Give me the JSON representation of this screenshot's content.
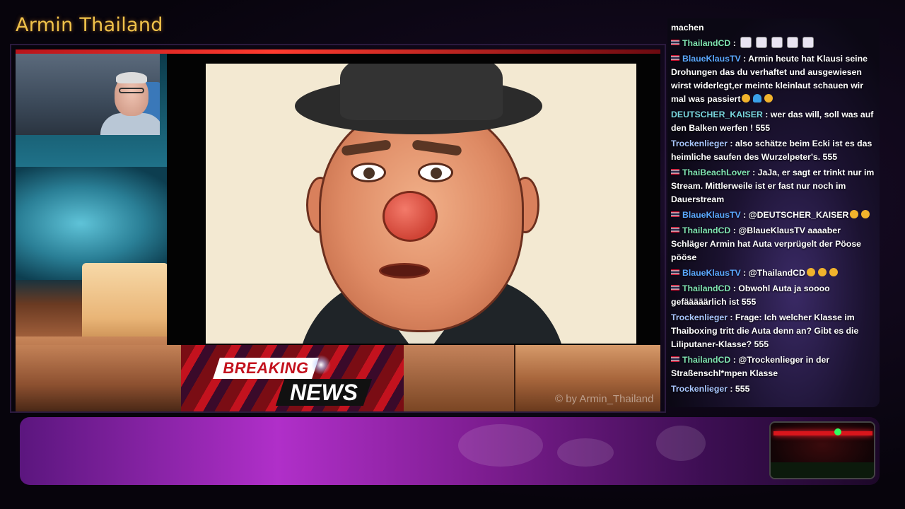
{
  "overlay": {
    "title": "Armin Thailand",
    "watermark": "© by Armin_Thailand"
  },
  "banner": {
    "breaking": "BREAKING",
    "news": "NEWS"
  },
  "chat": {
    "lead_text": "machen",
    "messages": [
      {
        "user": "ThailandCD",
        "user_color": "#7fe3b0",
        "flag": true,
        "text": "",
        "emotes": 5
      },
      {
        "user": "BlaueKlausTV",
        "user_color": "#5ba8ff",
        "flag": true,
        "text": "Armin heute hat Klausi seine Drohungen das du verhaftet und ausgewiesen wirst widerlegt,er meinte kleinlaut schauen wir mal was passiert"
      },
      {
        "user": "DEUTSCHER_KAISER",
        "user_color": "#7ad7e0",
        "flag": false,
        "text": "wer das will, soll was auf den Balken werfen ! 555"
      },
      {
        "user": "Trockenlieger",
        "user_color": "#a9c6ff",
        "flag": false,
        "text": "also schätze beim Ecki ist es das heimliche saufen des Wurzelpeter's. 555"
      },
      {
        "user": "ThaiBeachLover",
        "user_color": "#7fe3b0",
        "flag": true,
        "text": "JaJa, er sagt er trinkt nur im Stream. Mittlerweile ist er fast nur noch im Dauerstream"
      },
      {
        "user": "BlaueKlausTV",
        "user_color": "#5ba8ff",
        "flag": true,
        "text": "@DEUTSCHER_KAISER"
      },
      {
        "user": "ThailandCD",
        "user_color": "#7fe3b0",
        "flag": true,
        "text": "@BlaueKlausTV aaaaber Schläger Armin hat Auta verprügelt der Pöose pööse"
      },
      {
        "user": "BlaueKlausTV",
        "user_color": "#5ba8ff",
        "flag": true,
        "text": "@ThailandCD"
      },
      {
        "user": "ThailandCD",
        "user_color": "#7fe3b0",
        "flag": true,
        "text": "Obwohl Auta ja soooo gefääääärlich ist 555"
      },
      {
        "user": "Trockenlieger",
        "user_color": "#a9c6ff",
        "flag": false,
        "text": "Frage: Ich welcher Klasse im Thaiboxing tritt die Auta denn an? Gibt es die Liliputaner-Klasse? 555"
      },
      {
        "user": "ThailandCD",
        "user_color": "#7fe3b0",
        "flag": true,
        "text": "@Trockenlieger in der Straßenschl*mpen Klasse"
      },
      {
        "user": "Trockenlieger",
        "user_color": "#a9c6ff",
        "flag": false,
        "text": "555"
      }
    ]
  },
  "colors": {
    "title": "#f0c24a",
    "accent_red": "#c3121e",
    "chat_bg": "#1b1230",
    "bottom_purple": "#b02fc9"
  },
  "icons": {
    "flag": "thailand-flag-icon",
    "emote": "emote-icon",
    "laugh": "laughing-emoji-icon",
    "heart": "blue-heart-icon"
  }
}
